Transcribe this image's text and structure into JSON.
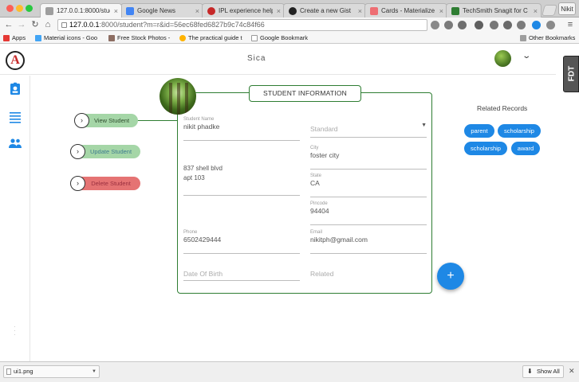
{
  "browser": {
    "tabs": [
      {
        "label": "127.0.0.1:8000/studen",
        "favicon_color": "#9e9e9e",
        "active": true
      },
      {
        "label": "Google News",
        "favicon_color": "#4285f4",
        "active": false
      },
      {
        "label": "IPL experience helps La",
        "favicon_color": "#c62828",
        "active": false
      },
      {
        "label": "Create a new Gist",
        "favicon_color": "#222222",
        "active": false
      },
      {
        "label": "Cards - Materialize",
        "favicon_color": "#ee6e73",
        "active": false
      },
      {
        "label": "TechSmith Snagit for C",
        "favicon_color": "#2e7d32",
        "active": false
      }
    ],
    "profile_label": "Nikit",
    "url_host": "127.0.0.1",
    "url_rest": ":8000/student?m=r&id=56ec68fed6827b9c74c84f66",
    "bookmarks": [
      {
        "label": "Apps",
        "icon_color": "#e53935"
      },
      {
        "label": "Material icons - Goo",
        "icon_color": "#42a5f5"
      },
      {
        "label": "Free Stock Photos -",
        "icon_color": "#8d6e63"
      },
      {
        "label": "The practical guide t",
        "icon_color": "#ffb300"
      },
      {
        "label": "Google Bookmark",
        "icon_color": "#bdbdbd"
      }
    ],
    "other_bookmarks": "Other Bookmarks"
  },
  "app": {
    "logo_letter": "A",
    "brand": "Sica",
    "fdt_label": "FDT",
    "actions": {
      "view": "View Student",
      "update": "Update Student",
      "delete": "Delete Student",
      "icon_glyph": "›"
    },
    "card": {
      "title": "STUDENT INFORMATION",
      "student_name_label": "Student Name",
      "student_name": "nikit phadke",
      "standard_placeholder": "Standard",
      "address_line1": "837 shell blvd",
      "address_line2": "apt 103",
      "city_label": "City",
      "city": "foster city",
      "state_label": "State",
      "state": "CA",
      "pincode_label": "Pincode",
      "pincode": "94404",
      "phone_label": "Phone",
      "phone": "6502429444",
      "email_label": "Email",
      "email": "nikitph@gmail.com",
      "dob_placeholder": "Date Of Birth",
      "related_placeholder": "Related"
    },
    "related": {
      "title": "Related Records",
      "chips": [
        "parent",
        "scholarship",
        "scholarship",
        "award"
      ],
      "chip_color": "#1e88e5"
    },
    "fab_label": "+"
  },
  "downloads": {
    "file": "ui1.png",
    "show_all": "Show All",
    "show_all_icon": "⬇",
    "close": "✕"
  }
}
